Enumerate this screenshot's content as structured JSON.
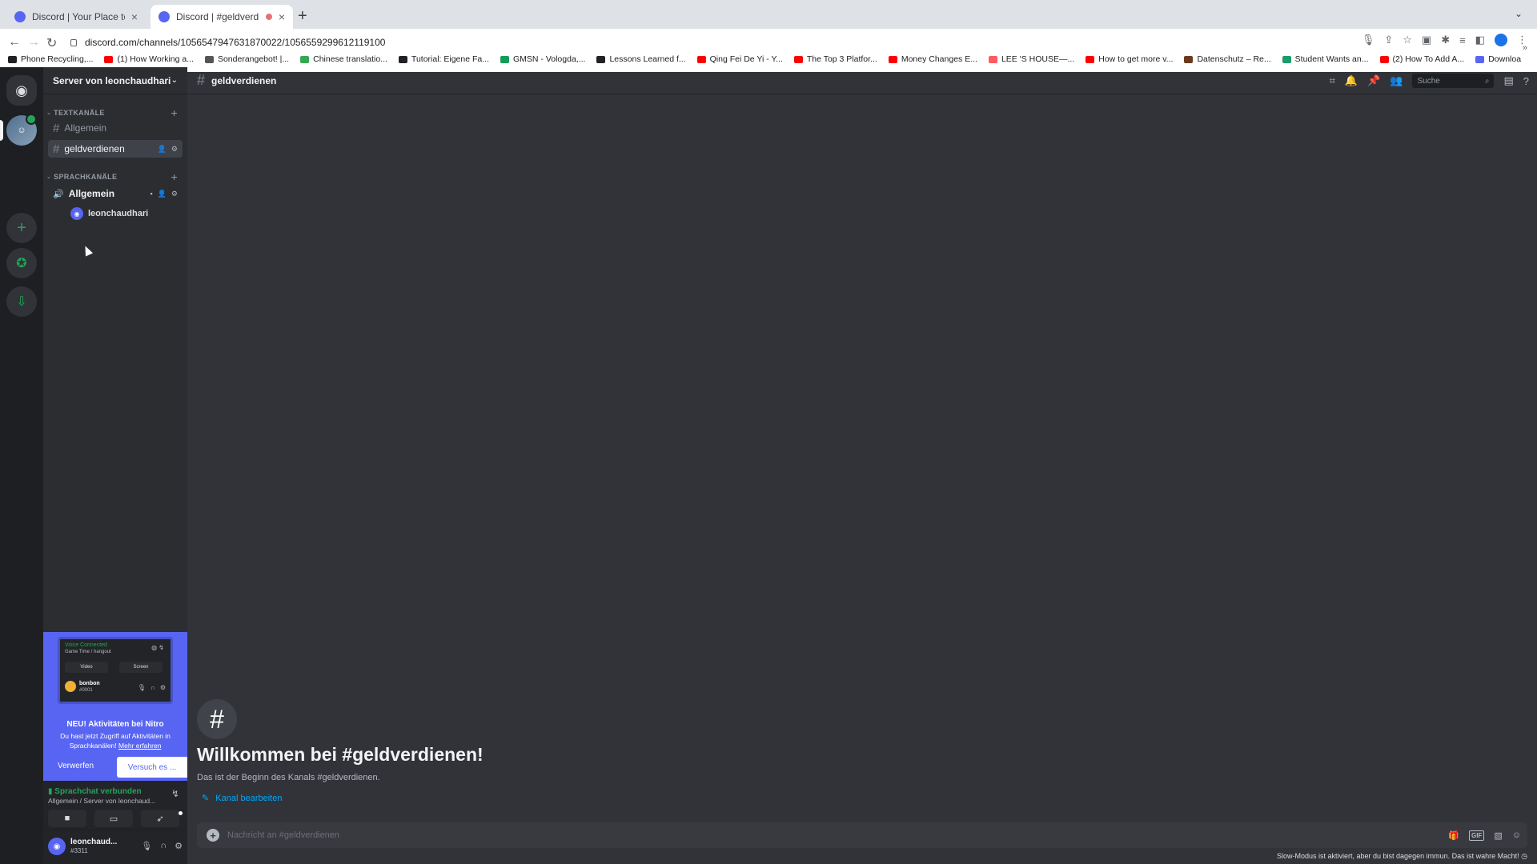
{
  "browser": {
    "tabs": [
      {
        "title": "Discord | Your Place to Talk and Hang Out",
        "active": false
      },
      {
        "title": "Discord | #geldverdienen |",
        "active": true
      }
    ],
    "url": "discord.com/channels/1056547947631870022/1056559299612119100",
    "bookmarks": [
      {
        "label": "Phone Recycling,...",
        "color": "#202124"
      },
      {
        "label": "(1) How Working a...",
        "color": "#ff0000"
      },
      {
        "label": "Sonderangebot! |...",
        "color": "#555555"
      },
      {
        "label": "Chinese translatio...",
        "color": "#34a853"
      },
      {
        "label": "Tutorial: Eigene Fa...",
        "color": "#202124"
      },
      {
        "label": "GMSN - Vologda,...",
        "color": "#0f9d58"
      },
      {
        "label": "Lessons Learned f...",
        "color": "#202124"
      },
      {
        "label": "Qing Fei De Yi - Y...",
        "color": "#ff0000"
      },
      {
        "label": "The Top 3 Platfor...",
        "color": "#ff0000"
      },
      {
        "label": "Money Changes E...",
        "color": "#ff0000"
      },
      {
        "label": "LEE 'S HOUSE—...",
        "color": "#ff5a5f"
      },
      {
        "label": "How to get more v...",
        "color": "#ff0000"
      },
      {
        "label": "Datenschutz – Re...",
        "color": "#6b3a1e"
      },
      {
        "label": "Student Wants an...",
        "color": "#1a9b6b"
      },
      {
        "label": "(2) How To Add A...",
        "color": "#ff0000"
      },
      {
        "label": "Download - Cooki...",
        "color": "#5865f2"
      }
    ]
  },
  "server": {
    "name": "Server von leonchaudhari"
  },
  "sidebar": {
    "text_category": "TEXTKANÄLE",
    "text_channels": [
      "Allgemein",
      "geldverdienen"
    ],
    "voice_category": "SPRACHKANÄLE",
    "voice_channel": "Allgemein",
    "voice_user": "leonchaudhari"
  },
  "promo": {
    "mock_voice": "Voice Connected",
    "mock_sub": "Game Time / hangout",
    "mock_video": "Video",
    "mock_screen": "Screen",
    "mock_user": "bonbon",
    "mock_tag": "#0001",
    "title": "NEU! Aktivitäten bei Nitro",
    "desc": "Du hast jetzt Zugriff auf Aktivitäten in Sprachkanälen!",
    "link": "Mehr erfahren",
    "dismiss": "Verwerfen",
    "try": "Versuch es ..."
  },
  "voice": {
    "status": "Sprachchat verbunden",
    "location": "Allgemein / Server von leonchaud..."
  },
  "user": {
    "name": "leonchaud...",
    "tag": "#3311"
  },
  "channel": {
    "name": "geldverdienen",
    "search_placeholder": "Suche",
    "welcome_title": "Willkommen bei #geldverdienen!",
    "welcome_sub": "Das ist der Beginn des Kanals #geldverdienen.",
    "edit_label": "Kanal bearbeiten",
    "composer_placeholder": "Nachricht an #geldverdienen",
    "gif_label": "GIF",
    "slowmode_text": "Slow-Modus ist aktiviert, aber du bist dagegen immun. Das ist wahre Macht!"
  }
}
